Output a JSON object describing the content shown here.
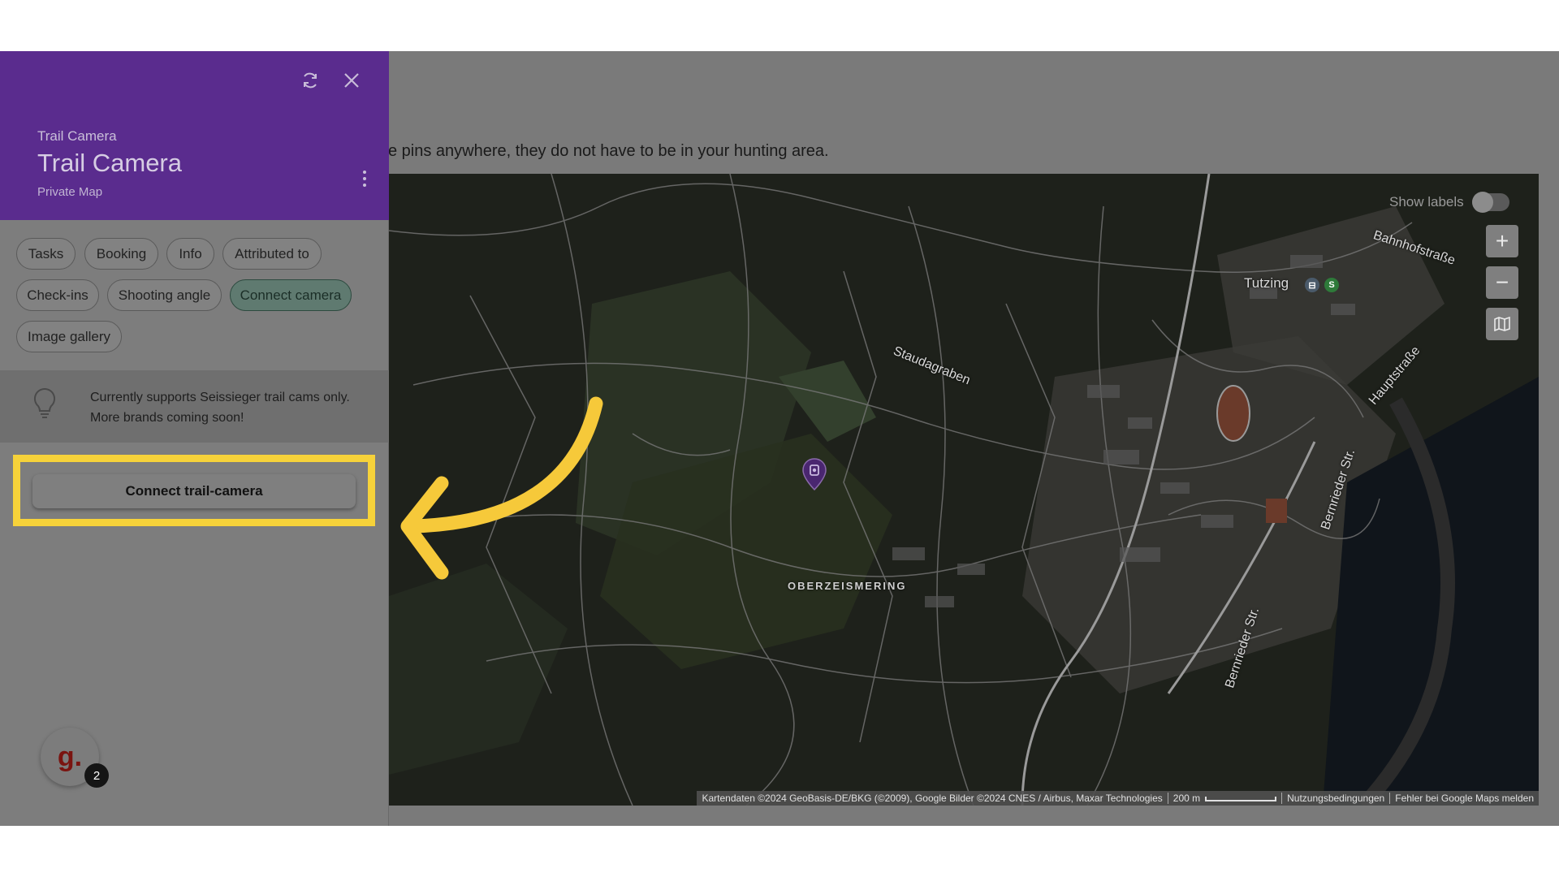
{
  "main": {
    "hint_text": "e pins anywhere, they do not have to be in your hunting area."
  },
  "panel": {
    "header": {
      "type_label": "Trail Camera",
      "title": "Trail Camera",
      "subtitle": "Private Map",
      "background_color": "#5a2c8e",
      "refresh_icon": "refresh-icon",
      "close_icon": "close-icon"
    },
    "chips": [
      {
        "label": "Tasks"
      },
      {
        "label": "Booking"
      },
      {
        "label": "Info"
      },
      {
        "label": "Attributed to"
      },
      {
        "label": "Check-ins"
      },
      {
        "label": "Shooting angle"
      },
      {
        "label": "Connect camera",
        "active": true
      },
      {
        "label": "Image gallery"
      }
    ],
    "tip": {
      "icon": "lightbulb-icon",
      "text": "Currently supports Seissieger trail cams only. More brands coming soon!"
    },
    "connect_button": {
      "label": "Connect trail-camera",
      "highlight_color": "#f6d23a"
    }
  },
  "map": {
    "show_labels": "Show labels",
    "labels_enabled": false,
    "zoom_in": "+",
    "zoom_out": "−",
    "places": {
      "staudagraben": "Staudagraben",
      "oberzeismering": "OBERZEISMERING",
      "tutzing": "Tutzing",
      "bahnhofstrasse": "Bahnhofstraße",
      "hauptstrasse": "Hauptstraße",
      "bernrieder1": "Bernrieder Str.",
      "bernrieder2": "Bernrieder Str."
    },
    "transit": {
      "bus": "⊟",
      "s_bahn": "S"
    },
    "attribution": {
      "data": "Kartendaten ©2024 GeoBasis-DE/BKG (©2009), Google Bilder ©2024 CNES / Airbus, Maxar Technologies",
      "scale": "200 m",
      "terms": "Nutzungsbedingungen",
      "report": "Fehler bei Google Maps melden"
    }
  },
  "assistant": {
    "avatar_letter": "g.",
    "badge_count": "2"
  },
  "annotation_color": "#f6c93a"
}
